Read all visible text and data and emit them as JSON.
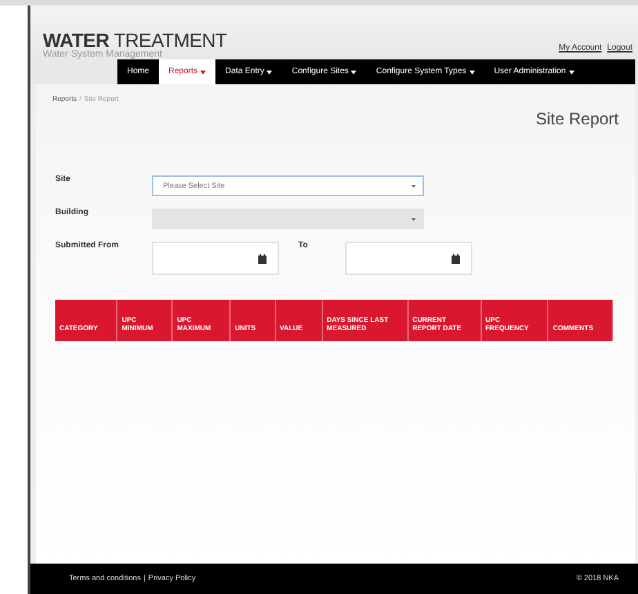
{
  "header": {
    "title_bold": "WATER",
    "title_light": "TREATMENT",
    "subtitle": "Water System Management",
    "links": [
      "My Account",
      "Logout"
    ]
  },
  "nav": [
    {
      "label": "Home",
      "selected": false,
      "dropdown": false
    },
    {
      "label": "Reports",
      "selected": true,
      "dropdown": true
    },
    {
      "label": "Data Entry",
      "selected": false,
      "dropdown": true
    },
    {
      "label": "Configure Sites",
      "selected": false,
      "dropdown": true
    },
    {
      "label": "Configure System Types",
      "selected": false,
      "dropdown": true
    },
    {
      "label": "User Administration",
      "selected": false,
      "dropdown": true
    }
  ],
  "breadcrumb": [
    "Reports",
    "Site Report"
  ],
  "breadcrumb_separator": "/",
  "page_title": "Site Report",
  "form": {
    "site": {
      "label": "Site",
      "placeholder": "Please Select Site",
      "disabled": false
    },
    "building": {
      "label": "Building",
      "disabled": true
    },
    "submitted_from": {
      "label": "Submitted From"
    },
    "to": {
      "label": "To"
    }
  },
  "table": {
    "columns": [
      [
        "CATEGORY"
      ],
      [
        "UPC",
        "MINIMUM"
      ],
      [
        "UPC",
        "MAXIMUM"
      ],
      [
        "UNITS"
      ],
      [
        "VALUE"
      ],
      [
        "DAYS SINCE LAST",
        "MEASURED"
      ],
      [
        "CURRENT",
        "REPORT DATE"
      ],
      [
        "UPC",
        "FREQUENCY"
      ],
      [
        "COMMENTS"
      ]
    ]
  },
  "footer": {
    "links": [
      "Terms and conditions",
      "Privacy Policy"
    ],
    "separator": "|",
    "copyright": "© 2018 NKA"
  }
}
